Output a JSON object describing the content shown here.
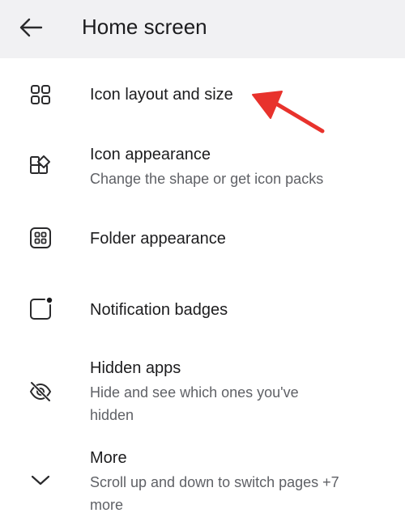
{
  "header": {
    "back_icon": "arrow-left-icon",
    "title": "Home screen"
  },
  "items": [
    {
      "icon": "grid-2x2-icon",
      "title": "Icon layout and size"
    },
    {
      "icon": "shapes-icon",
      "title": "Icon appearance",
      "subtitle": "Change the shape or get icon packs"
    },
    {
      "icon": "folder-grid-icon",
      "title": "Folder appearance"
    },
    {
      "icon": "badge-square-icon",
      "title": "Notification badges"
    },
    {
      "icon": "eye-off-icon",
      "title": "Hidden apps",
      "subtitle": "Hide and see which ones you've hidden"
    },
    {
      "icon": "chevron-down-icon",
      "title": "More",
      "subtitle": "Scroll up and down to switch pages +7 more"
    }
  ],
  "colors": {
    "header_bg": "#f1f1f3",
    "text_primary": "#1c1c1e",
    "text_secondary": "#5f6166",
    "annotation_arrow": "#e8322c"
  }
}
